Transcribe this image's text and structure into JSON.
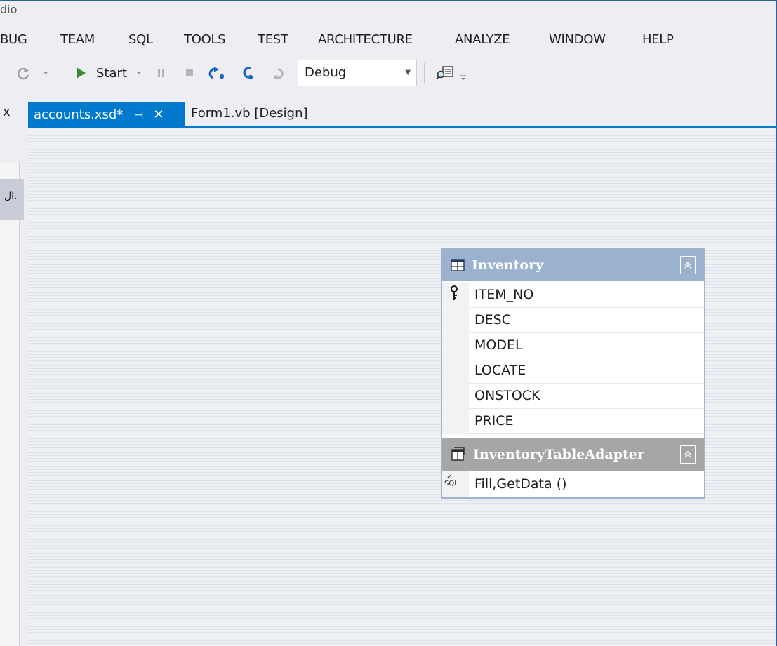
{
  "window": {
    "title_fragment": "dio"
  },
  "menu": {
    "items": [
      {
        "label": "BUG"
      },
      {
        "label": "TEAM"
      },
      {
        "label": "SQL"
      },
      {
        "label": "TOOLS"
      },
      {
        "label": "TEST"
      },
      {
        "label": "ARCHITECTURE"
      },
      {
        "label": "ANALYZE"
      },
      {
        "label": "WINDOW"
      },
      {
        "label": "HELP"
      }
    ]
  },
  "toolbar": {
    "start_label": "Start",
    "configuration": "Debug",
    "colors": {
      "start_green": "#388a34",
      "step_blue": "#1c64c8"
    }
  },
  "tabs": {
    "left_fragment": "x",
    "active": {
      "label": "accounts.xsd*",
      "pin_icon": "pin-icon",
      "close_icon": "close-icon"
    },
    "inactive": {
      "label": "Form1.vb [Design]"
    },
    "accent": "#007acc"
  },
  "left_panel": {
    "label_fragment": "ال."
  },
  "dataset": {
    "table": {
      "name": "Inventory",
      "columns": [
        {
          "name": "ITEM_NO",
          "primary_key": true
        },
        {
          "name": "DESC",
          "primary_key": false
        },
        {
          "name": "MODEL",
          "primary_key": false
        },
        {
          "name": "LOCATE",
          "primary_key": false
        },
        {
          "name": "ONSTOCK",
          "primary_key": false
        },
        {
          "name": "PRICE",
          "primary_key": false
        }
      ],
      "header_color": "#9ab1d0"
    },
    "adapter": {
      "name": "InventoryTableAdapter",
      "query": "Fill,GetData ()",
      "sql_icon_label": "SQL",
      "header_color": "#a6a6a6"
    }
  }
}
